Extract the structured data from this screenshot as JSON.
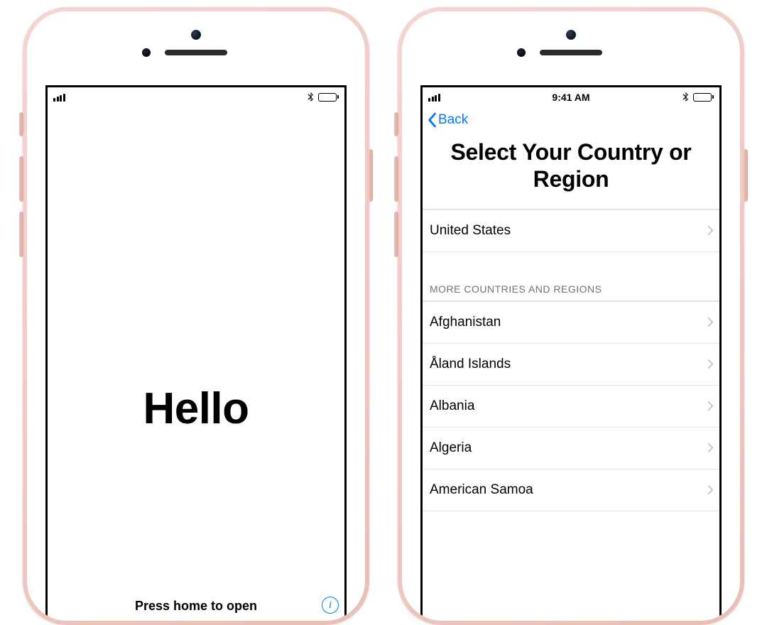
{
  "statusbar": {
    "time": "9:41 AM"
  },
  "screen1": {
    "greeting": "Hello",
    "hint": "Press home to open",
    "info_glyph": "i"
  },
  "screen2": {
    "back_label": "Back",
    "title": "Select Your Country or Region",
    "top_country": "United States",
    "more_header": "MORE COUNTRIES AND REGIONS",
    "countries": [
      "Afghanistan",
      "Åland Islands",
      "Albania",
      "Algeria",
      "American Samoa"
    ]
  }
}
